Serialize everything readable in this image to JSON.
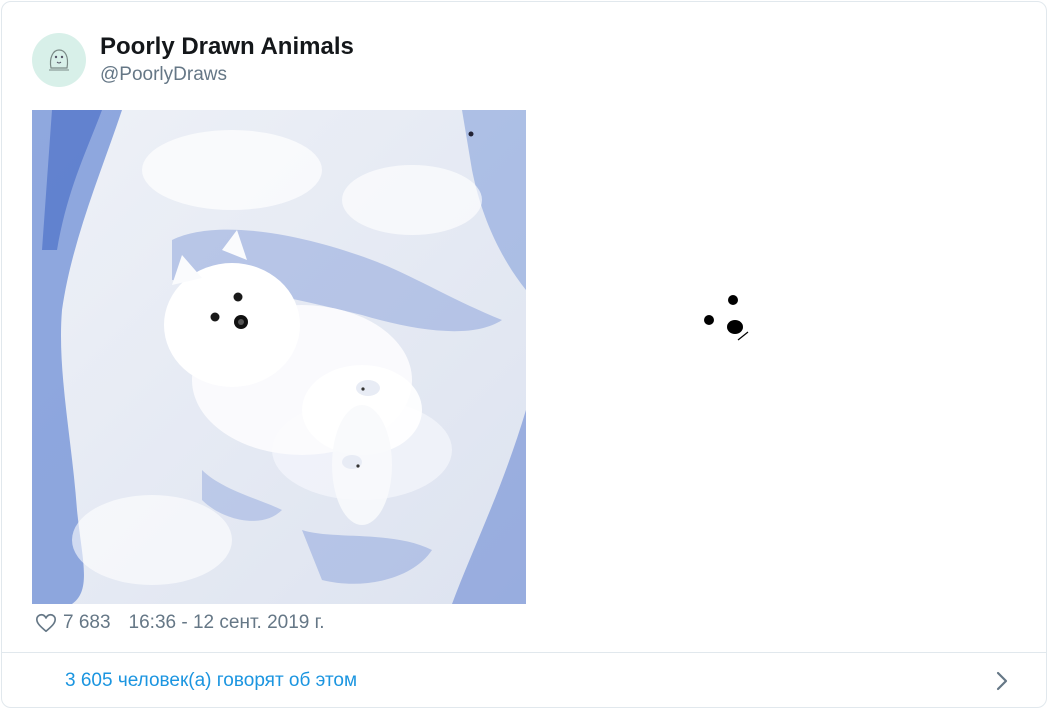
{
  "tweet": {
    "display_name": "Poorly Drawn Animals",
    "handle": "@PoorlyDraws",
    "likes": "7 683",
    "timestamp": "16:36 - 12 сент. 2019 г.",
    "engagement_text": "3 605 человек(а) говорят об этом"
  },
  "icons": {
    "avatar": "doodle-avatar-icon",
    "like": "heart-outline-icon",
    "more": "chevron-right-icon"
  },
  "colors": {
    "name": "#14171a",
    "secondary": "#657786",
    "link": "#1b95e0",
    "border": "#e1e8ed",
    "avatar_bg": "#d8f0e9"
  }
}
